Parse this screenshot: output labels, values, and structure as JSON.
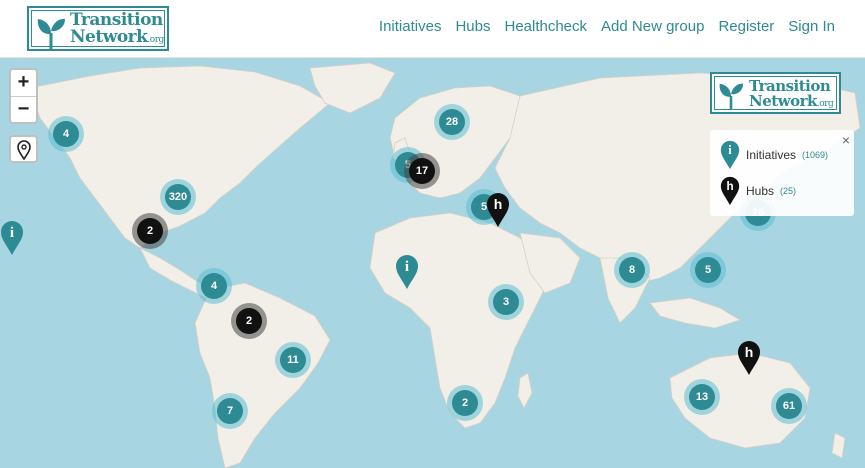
{
  "header": {
    "logo_line1": "Transition",
    "logo_line2": "Network",
    "logo_suffix": ".org",
    "nav": [
      "Initiatives",
      "Hubs",
      "Healthcheck",
      "Add New group",
      "Register",
      "Sign In"
    ]
  },
  "map": {
    "zoom_in": "+",
    "zoom_out": "−",
    "clusters": [
      {
        "label": "4",
        "kind": "initiative"
      },
      {
        "label": "320",
        "kind": "initiative"
      },
      {
        "label": "2",
        "kind": "hub"
      },
      {
        "label": "4",
        "kind": "initiative"
      },
      {
        "label": "2",
        "kind": "hub"
      },
      {
        "label": "11",
        "kind": "initiative"
      },
      {
        "label": "7",
        "kind": "initiative"
      },
      {
        "label": "28",
        "kind": "initiative"
      },
      {
        "label": "5",
        "kind": "initiative"
      },
      {
        "label": "17",
        "kind": "hub"
      },
      {
        "label": "5",
        "kind": "initiative"
      },
      {
        "label": "3",
        "kind": "initiative"
      },
      {
        "label": "2",
        "kind": "initiative"
      },
      {
        "label": "8",
        "kind": "initiative"
      },
      {
        "label": "5",
        "kind": "initiative"
      },
      {
        "label": "26",
        "kind": "initiative"
      },
      {
        "label": "13",
        "kind": "initiative"
      },
      {
        "label": "61",
        "kind": "initiative"
      }
    ]
  },
  "legend": {
    "logo_line1": "Transition",
    "logo_line2": "Network",
    "logo_suffix": ".org",
    "close": "×",
    "initiatives_label": "Initiatives",
    "initiatives_count": "(1069)",
    "hubs_label": "Hubs",
    "hubs_count": "(25)"
  },
  "colors": {
    "brand": "#2e8a93",
    "water": "#a8d5e2",
    "land": "#f2efe9",
    "hub": "#111111"
  }
}
